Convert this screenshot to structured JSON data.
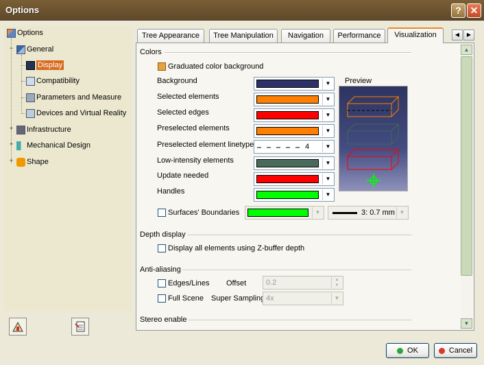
{
  "window": {
    "title": "Options",
    "help_icon": "question-icon",
    "close_icon": "close-icon"
  },
  "tree": {
    "items": [
      {
        "label": "Options",
        "icon": "options-icon"
      },
      {
        "label": "General",
        "icon": "general-icon"
      },
      {
        "label": "Display",
        "icon": "display-icon",
        "selected": true
      },
      {
        "label": "Compatibility",
        "icon": "compatibility-icon"
      },
      {
        "label": "Parameters and Measure",
        "icon": "parameters-icon"
      },
      {
        "label": "Devices and Virtual Reality",
        "icon": "devices-icon"
      },
      {
        "label": "Infrastructure",
        "icon": "infrastructure-icon"
      },
      {
        "label": "Mechanical Design",
        "icon": "mechanical-design-icon"
      },
      {
        "label": "Shape",
        "icon": "shape-icon"
      }
    ]
  },
  "tabs": [
    {
      "label": "Tree Appearance"
    },
    {
      "label": "Tree Manipulation"
    },
    {
      "label": "Navigation"
    },
    {
      "label": "Performance"
    },
    {
      "label": "Visualization",
      "active": true
    }
  ],
  "colors": {
    "section_title": "Colors",
    "graduated_label": "Graduated color background",
    "graduated_checked": true,
    "preview_label": "Preview",
    "rows": [
      {
        "label": "Background",
        "color": "#2d3168"
      },
      {
        "label": "Selected elements",
        "color": "#ff8000"
      },
      {
        "label": "Selected edges",
        "color": "#ff0000"
      },
      {
        "label": "Preselected elements",
        "color": "#ff8000"
      },
      {
        "label": "Preselected element linetype",
        "linetype": "4"
      },
      {
        "label": "Low-intensity elements",
        "color": "#4a6b5c"
      },
      {
        "label": "Update needed",
        "color": "#ff0000"
      },
      {
        "label": "Handles",
        "color": "#00ff00"
      }
    ],
    "surfaces_label": "Surfaces' Boundaries",
    "surfaces_color": "#00ff00",
    "surfaces_thickness": "3: 0.7 mm"
  },
  "depth": {
    "section_title": "Depth display",
    "zbuffer_label": "Display all elements using Z-buffer depth"
  },
  "antialiasing": {
    "section_title": "Anti-aliasing",
    "edges_label": "Edges/Lines",
    "offset_label": "Offset",
    "offset_value": "0.2",
    "fullscene_label": "Full Scene",
    "supersampling_label": "Super Sampling",
    "supersampling_value": "4x"
  },
  "stereo": {
    "section_title": "Stereo enable"
  },
  "buttons": {
    "ok": "OK",
    "cancel": "Cancel"
  }
}
